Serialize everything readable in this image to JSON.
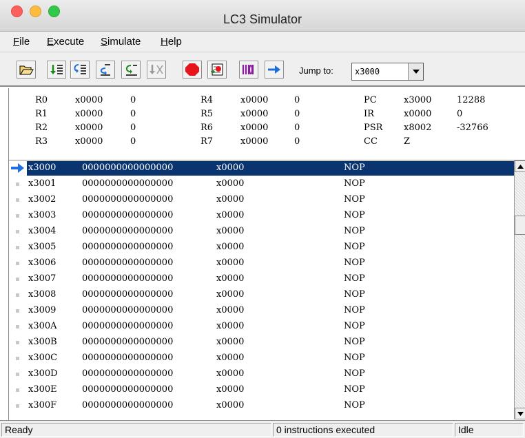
{
  "window": {
    "title": "LC3 Simulator"
  },
  "menu": [
    "File",
    "Execute",
    "Simulate",
    "Help"
  ],
  "toolbar": {
    "buttons": [
      {
        "name": "open-file-button",
        "icon": "folder-open-icon"
      },
      {
        "name": "step-into-button",
        "icon": "step-into-icon"
      },
      {
        "name": "step-over-button",
        "icon": "step-over-icon"
      },
      {
        "name": "step-out-button",
        "icon": "step-out-icon"
      },
      {
        "name": "run-to-button",
        "icon": "run-to-icon"
      },
      {
        "name": "disabled-step-button",
        "icon": "step-disabled-icon"
      },
      {
        "name": "stop-button",
        "icon": "stop-icon"
      },
      {
        "name": "breakpoint-button",
        "icon": "breakpoint-icon"
      },
      {
        "name": "memory-view-button",
        "icon": "binary-icon"
      },
      {
        "name": "jump-arrow-button",
        "icon": "arrow-right-icon"
      }
    ],
    "jump_label": "Jump to:",
    "jump_value": "x3000"
  },
  "registers": [
    {
      "name": "R0",
      "hex": "x0000",
      "dec": "0"
    },
    {
      "name": "R1",
      "hex": "x0000",
      "dec": "0"
    },
    {
      "name": "R2",
      "hex": "x0000",
      "dec": "0"
    },
    {
      "name": "R3",
      "hex": "x0000",
      "dec": "0"
    },
    {
      "name": "R4",
      "hex": "x0000",
      "dec": "0"
    },
    {
      "name": "R5",
      "hex": "x0000",
      "dec": "0"
    },
    {
      "name": "R6",
      "hex": "x0000",
      "dec": "0"
    },
    {
      "name": "R7",
      "hex": "x0000",
      "dec": "0"
    },
    {
      "name": "PC",
      "hex": "x3000",
      "dec": "12288"
    },
    {
      "name": "IR",
      "hex": "x0000",
      "dec": "0"
    },
    {
      "name": "PSR",
      "hex": "x8002",
      "dec": "-32766"
    },
    {
      "name": "CC",
      "hex": "Z",
      "dec": ""
    }
  ],
  "memory": [
    {
      "addr": "x3000",
      "bin": "0000000000000000",
      "hex": "x0000",
      "instr": "NOP"
    },
    {
      "addr": "x3001",
      "bin": "0000000000000000",
      "hex": "x0000",
      "instr": "NOP"
    },
    {
      "addr": "x3002",
      "bin": "0000000000000000",
      "hex": "x0000",
      "instr": "NOP"
    },
    {
      "addr": "x3003",
      "bin": "0000000000000000",
      "hex": "x0000",
      "instr": "NOP"
    },
    {
      "addr": "x3004",
      "bin": "0000000000000000",
      "hex": "x0000",
      "instr": "NOP"
    },
    {
      "addr": "x3005",
      "bin": "0000000000000000",
      "hex": "x0000",
      "instr": "NOP"
    },
    {
      "addr": "x3006",
      "bin": "0000000000000000",
      "hex": "x0000",
      "instr": "NOP"
    },
    {
      "addr": "x3007",
      "bin": "0000000000000000",
      "hex": "x0000",
      "instr": "NOP"
    },
    {
      "addr": "x3008",
      "bin": "0000000000000000",
      "hex": "x0000",
      "instr": "NOP"
    },
    {
      "addr": "x3009",
      "bin": "0000000000000000",
      "hex": "x0000",
      "instr": "NOP"
    },
    {
      "addr": "x300A",
      "bin": "0000000000000000",
      "hex": "x0000",
      "instr": "NOP"
    },
    {
      "addr": "x300B",
      "bin": "0000000000000000",
      "hex": "x0000",
      "instr": "NOP"
    },
    {
      "addr": "x300C",
      "bin": "0000000000000000",
      "hex": "x0000",
      "instr": "NOP"
    },
    {
      "addr": "x300D",
      "bin": "0000000000000000",
      "hex": "x0000",
      "instr": "NOP"
    },
    {
      "addr": "x300E",
      "bin": "0000000000000000",
      "hex": "x0000",
      "instr": "NOP"
    },
    {
      "addr": "x300F",
      "bin": "0000000000000000",
      "hex": "x0000",
      "instr": "NOP"
    }
  ],
  "status": {
    "message": "Ready",
    "count": "0 instructions executed",
    "state": "Idle"
  },
  "colors": {
    "selection": "#0a3470",
    "pc_arrow": "#1f6fe0",
    "stop": "#e8141c",
    "binary_purple": "#8a1f9c"
  }
}
